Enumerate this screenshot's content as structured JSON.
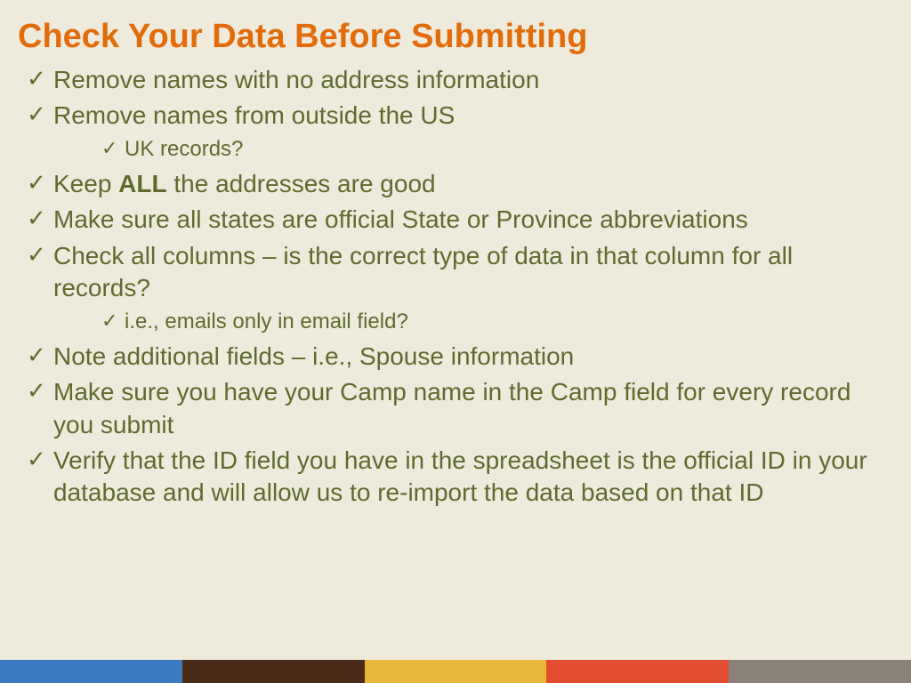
{
  "title": "Check Your Data Before Submitting",
  "items": [
    {
      "text": "Remove names with no address information"
    },
    {
      "text": "Remove names from outside the US",
      "sub": [
        "UK records?"
      ]
    },
    {
      "prefix": "Keep ",
      "bold": "ALL",
      "suffix": " the addresses are good"
    },
    {
      "text": "Make sure all states are official State or Province abbreviations"
    },
    {
      "text": "Check all columns – is the correct type of data in that column for all records?",
      "sub": [
        "i.e., emails only in email field?"
      ]
    },
    {
      "text": "Note additional fields – i.e., Spouse information"
    },
    {
      "text": "Make sure you have your Camp name in the Camp field for every record you submit"
    },
    {
      "text": "Verify that the ID field you have in the spreadsheet is the official ID in your database and will allow us to re-import the data based on that ID"
    }
  ],
  "stripe_colors": [
    "#3b7bbf",
    "#4a2a18",
    "#e8b63a",
    "#e24e2f",
    "#8a8278"
  ]
}
